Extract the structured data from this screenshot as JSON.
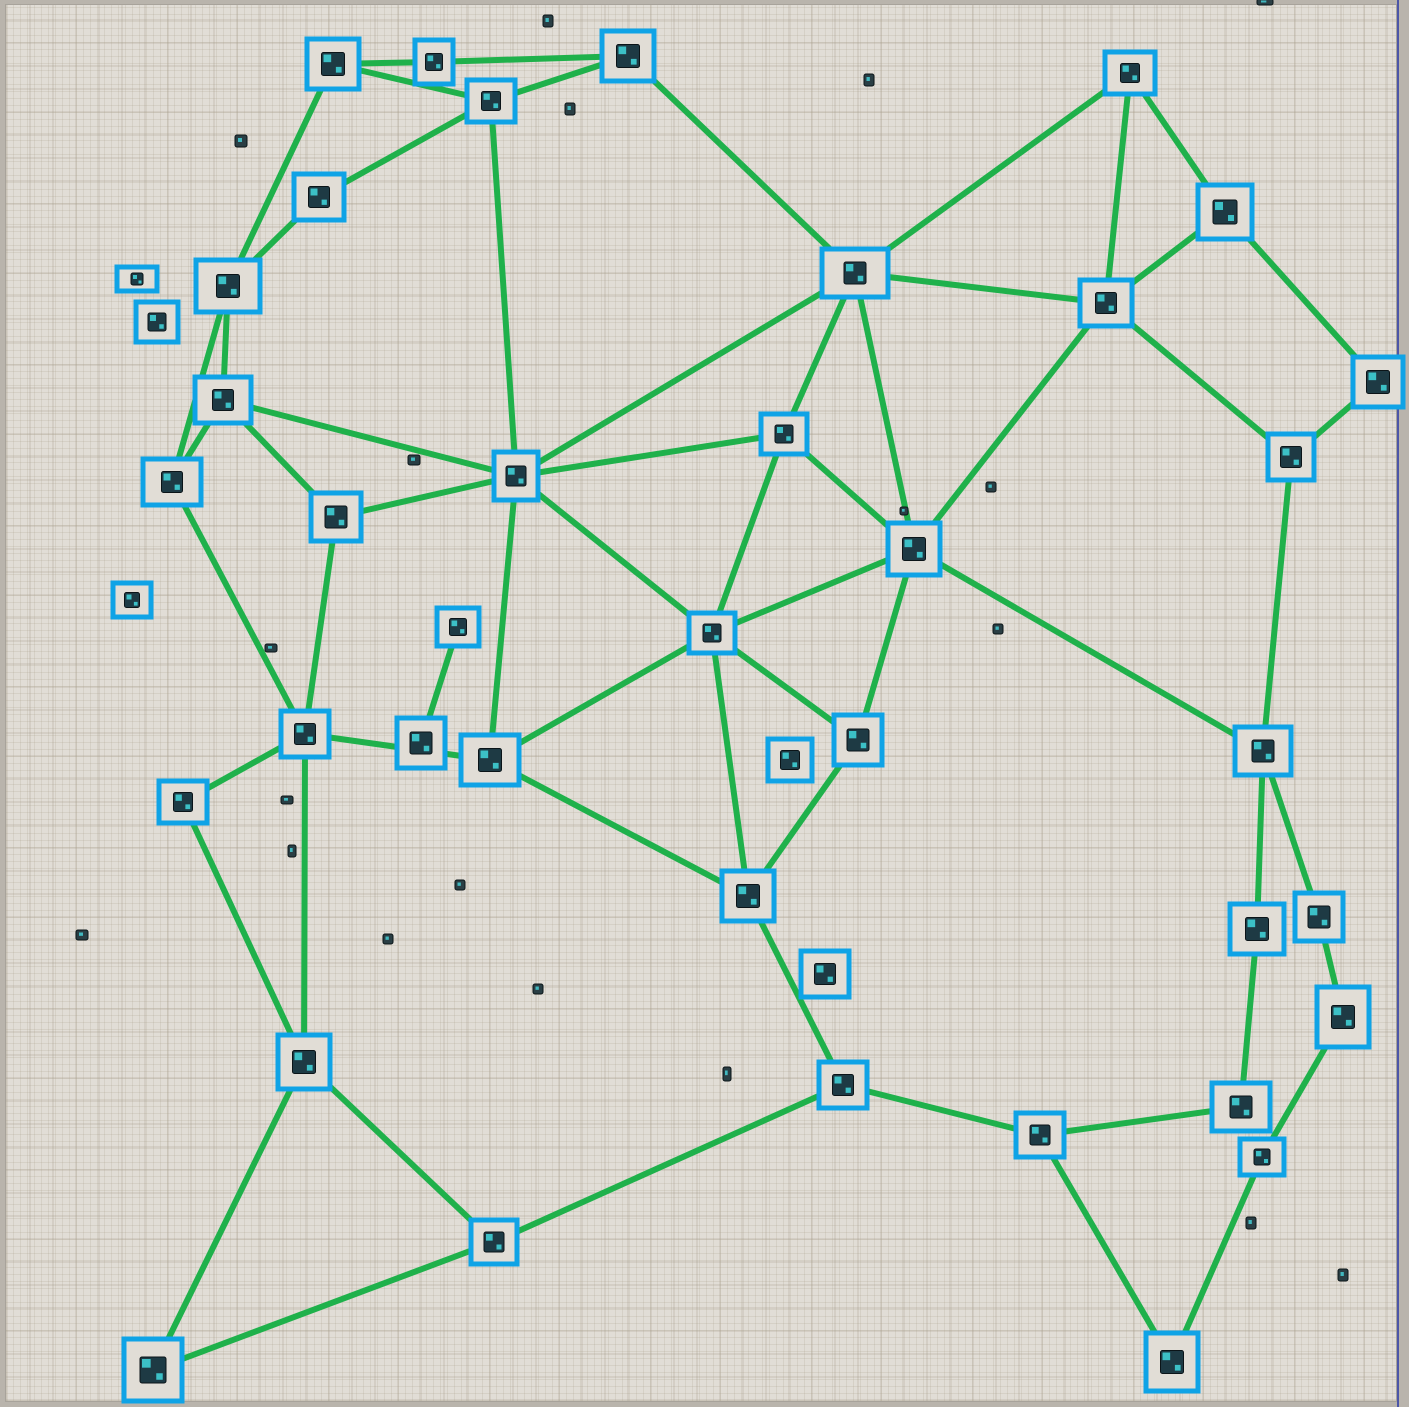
{
  "colors": {
    "board": "#e1ddd6",
    "edge": "#1fb14b",
    "node_box": "#0fa3e6",
    "sprite": "#1e3a44",
    "sprite_highlight": "#3cc0c6"
  },
  "graph": {
    "node_count": 51,
    "edge_count": 72
  }
}
